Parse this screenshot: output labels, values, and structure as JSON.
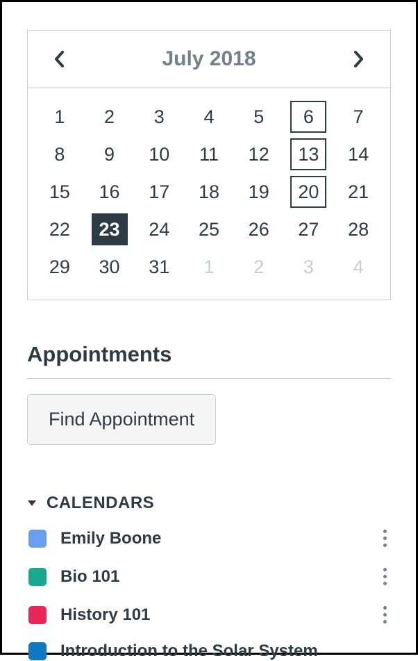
{
  "calendar": {
    "month_label": "July 2018",
    "days": [
      {
        "n": "1"
      },
      {
        "n": "2"
      },
      {
        "n": "3"
      },
      {
        "n": "4"
      },
      {
        "n": "5"
      },
      {
        "n": "6",
        "boxed": true
      },
      {
        "n": "7"
      },
      {
        "n": "8"
      },
      {
        "n": "9"
      },
      {
        "n": "10"
      },
      {
        "n": "11"
      },
      {
        "n": "12"
      },
      {
        "n": "13",
        "boxed": true
      },
      {
        "n": "14"
      },
      {
        "n": "15"
      },
      {
        "n": "16"
      },
      {
        "n": "17"
      },
      {
        "n": "18"
      },
      {
        "n": "19"
      },
      {
        "n": "20",
        "boxed": true
      },
      {
        "n": "21"
      },
      {
        "n": "22"
      },
      {
        "n": "23",
        "selected": true
      },
      {
        "n": "24"
      },
      {
        "n": "25"
      },
      {
        "n": "26"
      },
      {
        "n": "27"
      },
      {
        "n": "28"
      },
      {
        "n": "29"
      },
      {
        "n": "30"
      },
      {
        "n": "31"
      },
      {
        "n": "1",
        "other": true
      },
      {
        "n": "2",
        "other": true
      },
      {
        "n": "3",
        "other": true
      },
      {
        "n": "4",
        "other": true
      }
    ]
  },
  "appointments": {
    "header": "Appointments",
    "button_label": "Find Appointment"
  },
  "calendars_section": {
    "header": "CALENDARS",
    "items": [
      {
        "label": "Emily Boone",
        "color": "#6b9df0",
        "has_more": true
      },
      {
        "label": "Bio 101",
        "color": "#1aa890",
        "has_more": true
      },
      {
        "label": "History 101",
        "color": "#e8265a",
        "has_more": true
      },
      {
        "label": "Introduction to the Solar System",
        "color": "#1077c5",
        "has_more": false
      }
    ]
  }
}
